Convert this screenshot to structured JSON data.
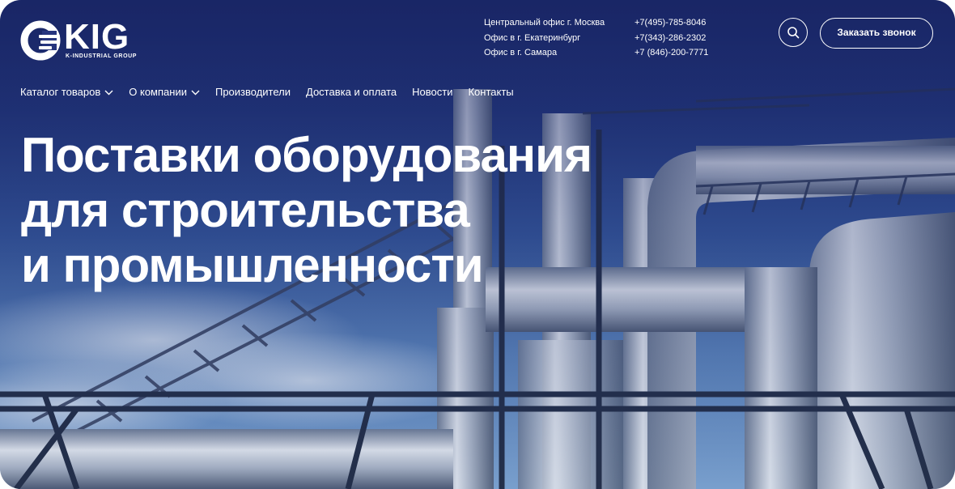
{
  "brand": {
    "logo_text": "KIG",
    "logo_subtitle": "K-INDUSTRIAL GROUP"
  },
  "offices": [
    {
      "name": "Центральный офис г. Москва",
      "phone": "+7(495)-785-8046"
    },
    {
      "name": "Офис в г. Екатеринбург",
      "phone": "+7(343)-286-2302"
    },
    {
      "name": "Офис в г. Самара",
      "phone": "+7 (846)-200-7771"
    }
  ],
  "header": {
    "search_icon": "search-icon",
    "call_button_label": "Заказать звонок"
  },
  "nav": {
    "items": [
      {
        "label": "Каталог товаров",
        "has_dropdown": true
      },
      {
        "label": "О компании",
        "has_dropdown": true
      },
      {
        "label": "Производители",
        "has_dropdown": false
      },
      {
        "label": "Доставка и оплата",
        "has_dropdown": false
      },
      {
        "label": "Новости",
        "has_dropdown": false
      },
      {
        "label": "Контакты",
        "has_dropdown": false
      }
    ]
  },
  "hero": {
    "headline_lines": [
      "Поставки оборудования",
      "для строительства",
      "и промышленности"
    ]
  },
  "colors": {
    "overlay": "#1c2a78",
    "text": "#ffffff",
    "pipe": "#c4ccd8"
  }
}
